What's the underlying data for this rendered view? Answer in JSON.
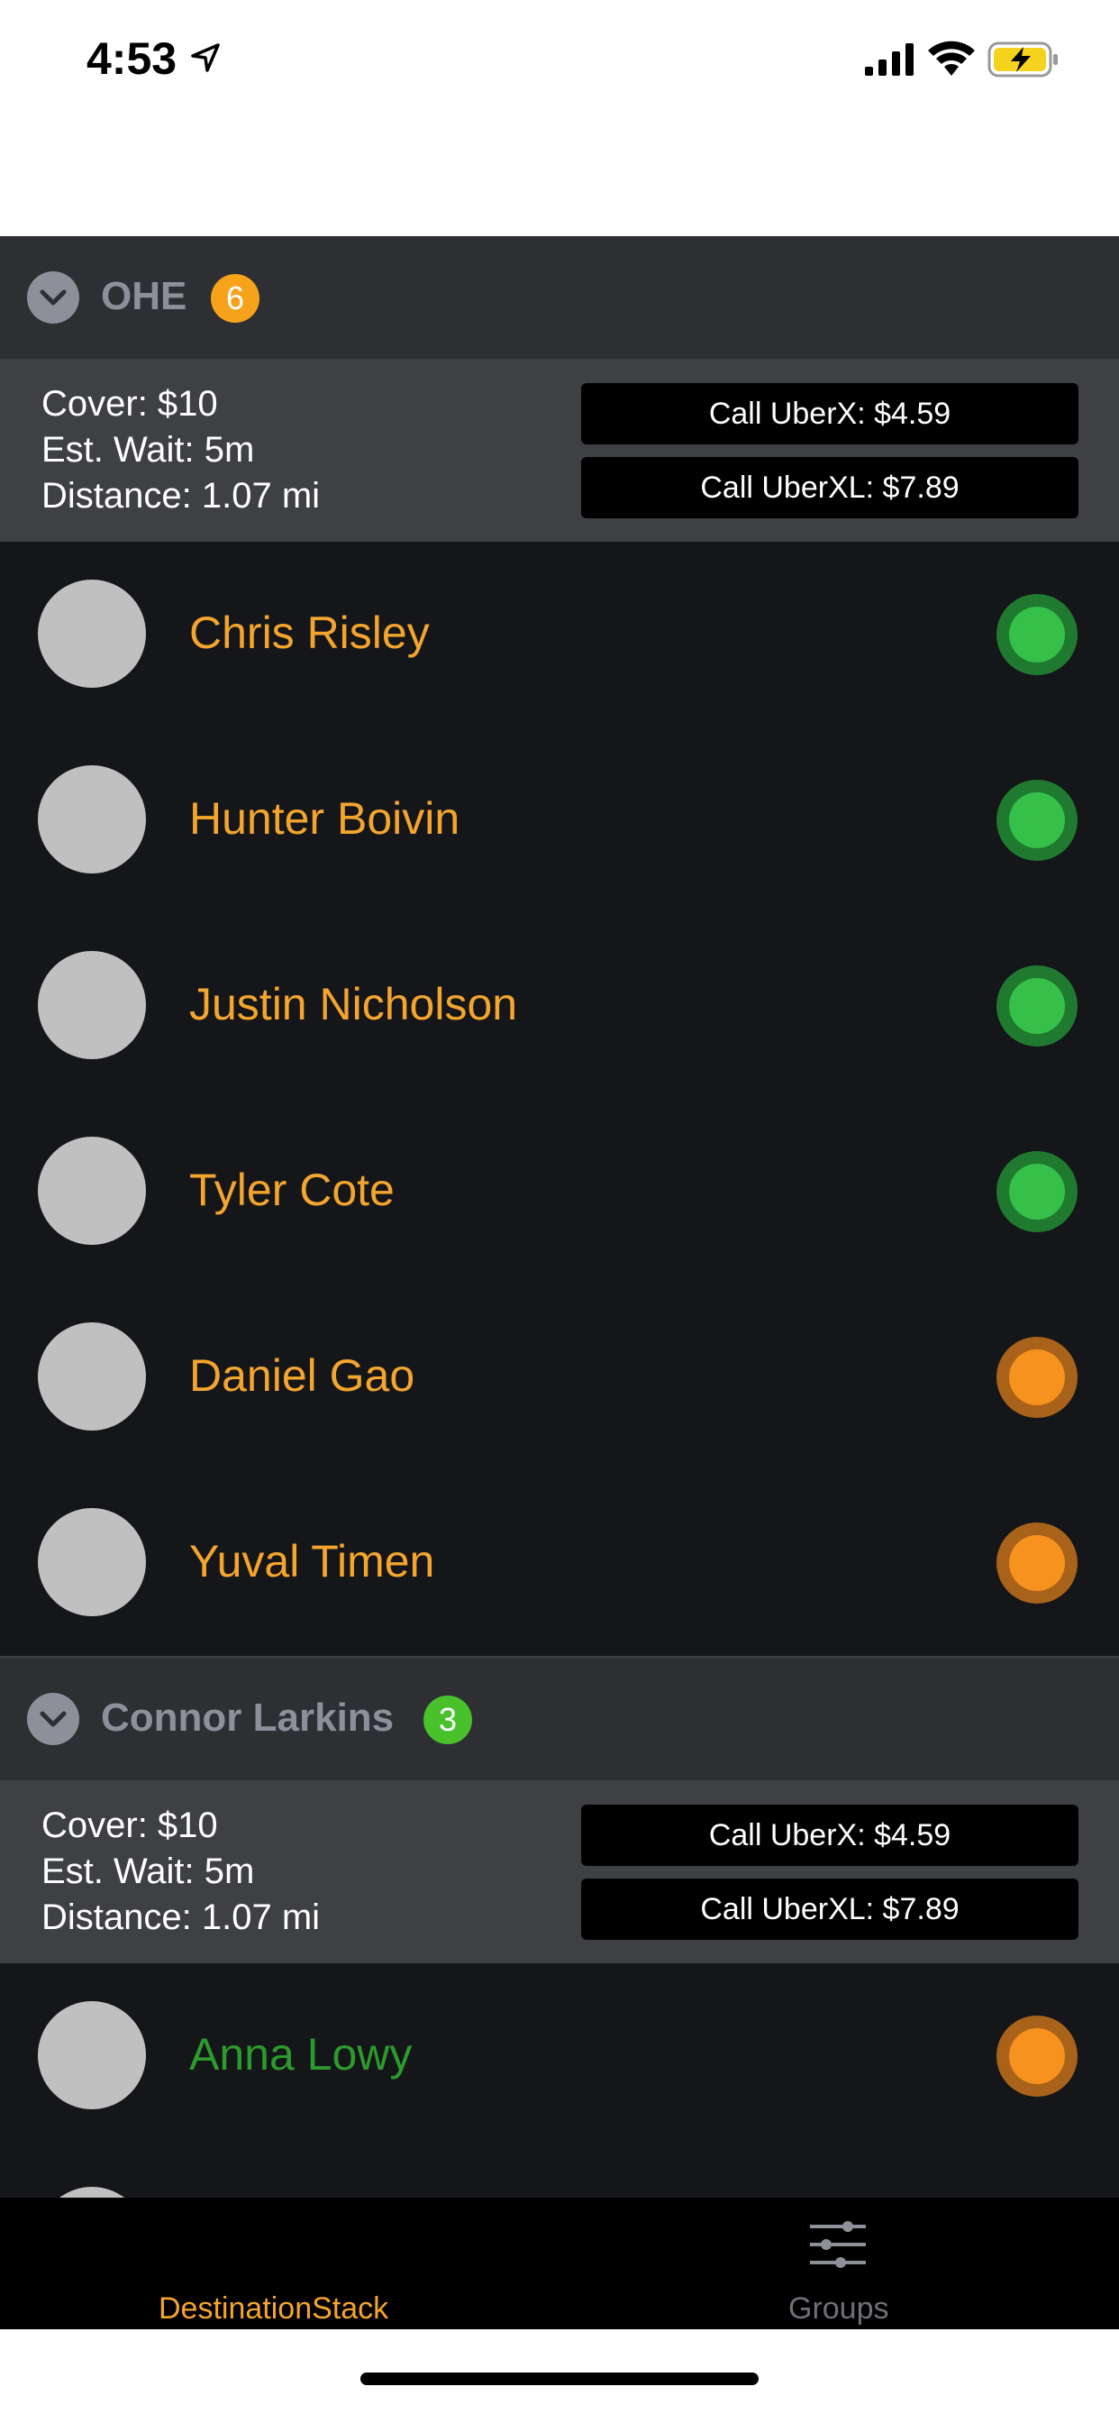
{
  "status_bar": {
    "time": "4:53"
  },
  "colors": {
    "accent": "#f5a52d",
    "online": "#35c04a",
    "away": "#f7921e",
    "green_name": "#2b9b2b",
    "badge_orange": "#f7a21b",
    "badge_green": "#49c12b"
  },
  "groups": [
    {
      "title": "OHE",
      "count": "6",
      "cover": "Cover: $10",
      "wait": "Est. Wait: 5m",
      "distance": "Distance: 1.07 mi",
      "uberx": "Call UberX: $4.59",
      "uberxl": "Call UberXL: $7.89",
      "members": [
        {
          "name": "Chris Risley",
          "status": "online"
        },
        {
          "name": "Hunter Boivin",
          "status": "online"
        },
        {
          "name": "Justin Nicholson",
          "status": "online"
        },
        {
          "name": "Tyler Cote",
          "status": "online"
        },
        {
          "name": "Daniel Gao",
          "status": "away"
        },
        {
          "name": "Yuval Timen",
          "status": "away"
        }
      ]
    },
    {
      "title": "Connor Larkins",
      "count": "3",
      "cover": "Cover: $10",
      "wait": "Est. Wait: 5m",
      "distance": "Distance: 1.07 mi",
      "uberx": "Call UberX: $4.59",
      "uberxl": "Call UberXL: $7.89",
      "members": [
        {
          "name": "Anna Lowy",
          "status": "away"
        }
      ]
    }
  ],
  "tabs": [
    {
      "label": "DestinationStack",
      "icon": "destination-icon",
      "active": true
    },
    {
      "label": "Groups",
      "icon": "sliders-icon",
      "active": false
    }
  ]
}
